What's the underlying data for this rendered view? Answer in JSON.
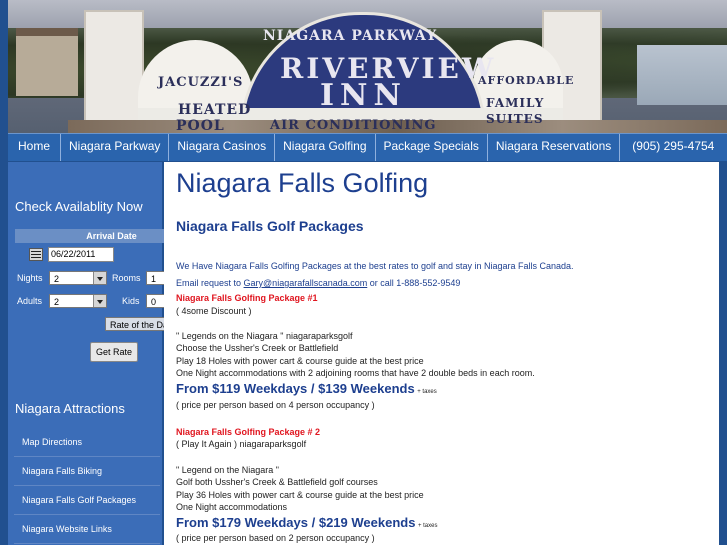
{
  "banner": {
    "parkway": "NIAGARA PARKWAY",
    "riverview": "RIVERVIEW",
    "inn": "INN",
    "jacuzzis": "JACUZZI'S",
    "heated": "HEATED",
    "pool": "POOL",
    "affordable": "AFFORDABLE",
    "family": "FAMILY",
    "suites": "SUITES",
    "air_conditioning": "AIR CONDITIONING"
  },
  "nav": {
    "items": [
      {
        "label": "Home"
      },
      {
        "label": "Niagara Parkway"
      },
      {
        "label": "Niagara Casinos"
      },
      {
        "label": "Niagara Golfing"
      },
      {
        "label": "Package Specials"
      },
      {
        "label": "Niagara Reservations"
      },
      {
        "label": "(905) 295-4754"
      }
    ]
  },
  "sidebar": {
    "check_heading": "Check Availablity Now",
    "arrival_label": "Arrival Date",
    "arrival_date": "06/22/2011",
    "nights_label": "Nights",
    "nights_value": "2",
    "rooms_label": "Rooms",
    "rooms_value": "1",
    "adults_label": "Adults",
    "adults_value": "2",
    "kids_label": "Kids",
    "kids_value": "0",
    "rate_value": "Rate of the Day",
    "get_rate": "Get Rate",
    "attractions_heading": "Niagara Attractions",
    "links": [
      {
        "label": "Map Directions"
      },
      {
        "label": "Niagara Falls Biking"
      },
      {
        "label": "Niagara Falls Golf Packages"
      },
      {
        "label": "Niagara Website Links"
      }
    ]
  },
  "main": {
    "title": "Niagara Falls Golfing",
    "subtitle": "Niagara Falls Golf Packages",
    "intro": "We Have Niagara Falls Golfing Packages at the best rates to golf and stay in Niagara Falls Canada.",
    "request_prefix": "Email request to",
    "email": "Gary@niagarafallscanada.com",
    "request_mid": "or call",
    "phone": "1-888-552-9549",
    "pkg1_title": "Niagara Falls Golfing Package #1",
    "pkg1_note": "( 4some Discount )",
    "pkg1_lines": [
      "\" Legends on the Niagara \" niagaraparksgolf",
      "Choose the Ussher's Creek or Battlefield",
      "Play 18 Holes with power cart & course guide at the best price",
      "One Night accommodations with 2 adjoining rooms that have 2 double beds in each room."
    ],
    "pkg1_price": "From $119 Weekdays / $139 Weekends",
    "pkg1_taxes": "+ taxes",
    "pkg1_occupancy": "( price per person based on 4 person occupancy )",
    "pkg2_title": "Niagara Falls Golfing Package # 2",
    "pkg2_note": "( Play It Again ) niagaraparksgolf",
    "pkg2_lines": [
      "\" Legend on the Niagara \"",
      "Golf both Ussher's Creek & Battlefield golf courses",
      "Play 36 Holes with power cart & course guide at the best price",
      "One Night accommodations"
    ],
    "pkg2_price": "From $179 Weekdays / $219 Weekends",
    "pkg2_taxes": "+ taxes",
    "pkg2_occupancy": "( price per person based on 2 person occupancy )"
  }
}
